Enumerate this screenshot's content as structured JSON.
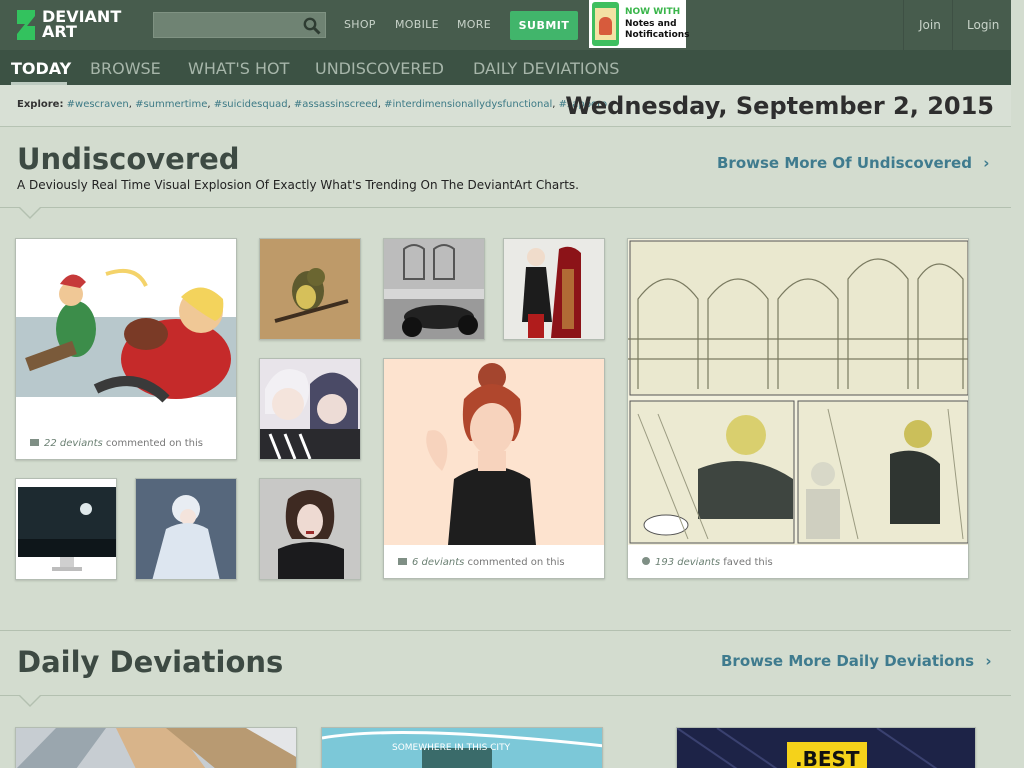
{
  "header": {
    "logo_line1": "DEVIANT",
    "logo_line2": "ART",
    "search_placeholder": "",
    "nav": [
      "SHOP",
      "MOBILE",
      "MORE"
    ],
    "submit_label": "SUBMIT",
    "promo": {
      "line1": "NOW WITH",
      "line2": "Notes and",
      "line3": "Notifications"
    },
    "join": "Join",
    "login": "Login"
  },
  "tabs": [
    {
      "label": "TODAY",
      "active": true
    },
    {
      "label": "BROWSE",
      "active": false
    },
    {
      "label": "WHAT'S HOT",
      "active": false
    },
    {
      "label": "UNDISCOVERED",
      "active": false
    },
    {
      "label": "DAILY DEVIATIONS",
      "active": false
    }
  ],
  "explore": {
    "label": "Explore:",
    "tags": [
      "#wescraven",
      "#summertime",
      "#suicidesquad",
      "#assassinscreed",
      "#interdimensionallydysfunctional",
      "#sapporo"
    ]
  },
  "date": "Wednesday, September 2, 2015",
  "undiscovered": {
    "title": "Undiscovered",
    "subtitle": "A Deviously Real Time Visual Explosion Of Exactly What's Trending On The DeviantArt Charts.",
    "more": "Browse More Of Undiscovered",
    "cards": [
      {
        "count": "22 deviants",
        "action": "commented on this"
      },
      {
        "count": "6 deviants",
        "action": "commented on this"
      },
      {
        "count": "193 deviants",
        "action": "faved this"
      }
    ]
  },
  "daily": {
    "title": "Daily Deviations",
    "more": "Browse More Daily Deviations",
    "thumb_caption": "SOMEWHERE IN THIS CITY",
    "ad_text": ".BEST"
  },
  "colors": {
    "accent": "#41b56b",
    "topbar": "#475c4d",
    "subnav": "#3c5244",
    "link": "#3f7b8e",
    "page": "#d3dccf"
  }
}
